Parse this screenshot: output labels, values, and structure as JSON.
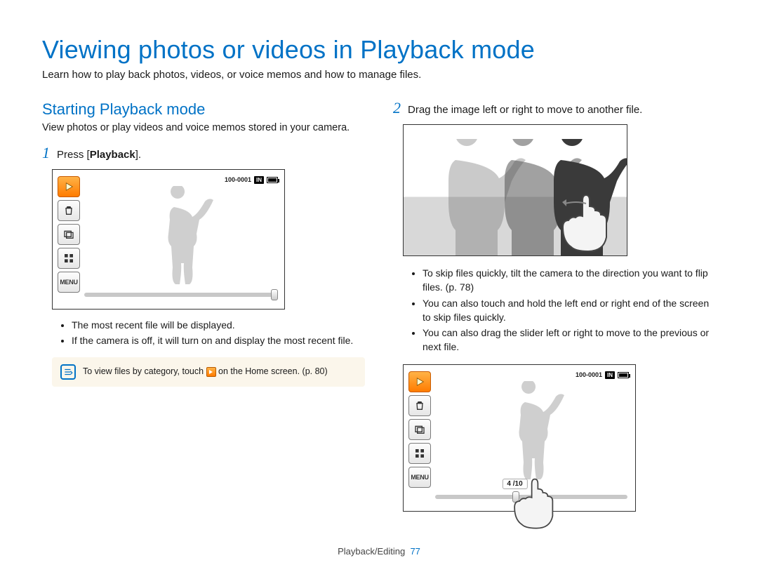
{
  "header": {
    "title": "Viewing photos or videos in Playback mode",
    "intro": "Learn how to play back photos, videos, or voice memos and how to manage files."
  },
  "left": {
    "section_title": "Starting Playback mode",
    "section_desc": "View photos or play videos and voice memos stored in your camera.",
    "step1_num": "1",
    "step1_text_prefix": "Press [",
    "step1_text_bold": "Playback",
    "step1_text_suffix": "].",
    "bullets": [
      "The most recent file will be displayed.",
      "If the camera is off, it will turn on and display the most recent file."
    ],
    "note_prefix": "To view files by category, touch ",
    "note_suffix": " on the Home screen. (p. 80)"
  },
  "right": {
    "step2_num": "2",
    "step2_text": "Drag the image left or right to move to another file.",
    "bullets": [
      "To skip files quickly, tilt the camera to the direction you want to flip files. (p. 78)",
      "You can also touch and hold the left end or right end of the screen to skip files quickly.",
      "You can also drag the slider left or right to move to the previous or next file."
    ]
  },
  "screen": {
    "file_id": "100-0001",
    "in_label": "IN",
    "menu_label": "MENU",
    "counter": "4 /10",
    "icons": {
      "play": "play-icon",
      "trash": "trash-icon",
      "slideshow": "slideshow-icon",
      "thumbnails": "thumbnails-icon",
      "menu": "menu-icon"
    }
  },
  "footer": {
    "section": "Playback/Editing",
    "page": "77"
  }
}
